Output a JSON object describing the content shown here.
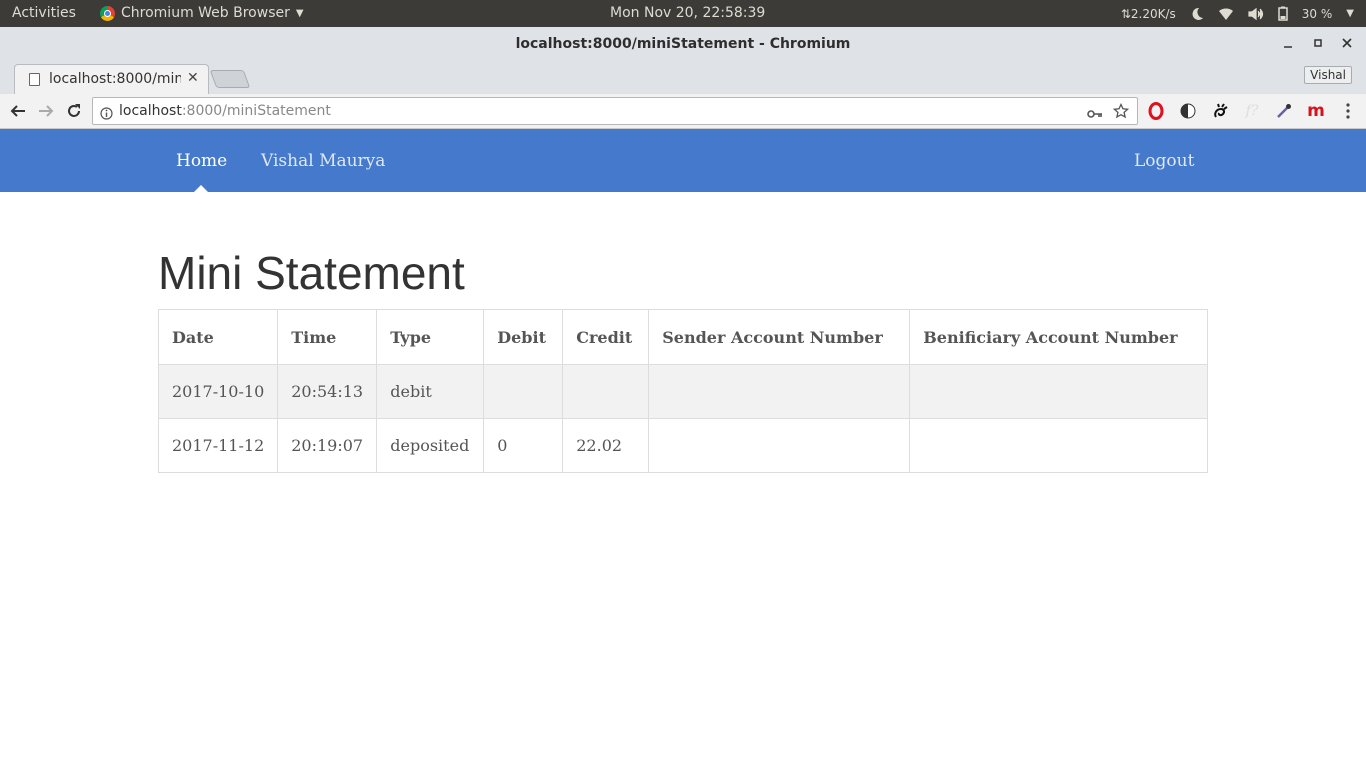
{
  "system_bar": {
    "activities": "Activities",
    "app_name": "Chromium Web Browser",
    "clock": "Mon Nov 20, 22:58:39",
    "net_speed": "⇅2.20K/s",
    "battery": "30 %"
  },
  "window": {
    "title": "localhost:8000/miniStatement - Chromium"
  },
  "tabs": [
    {
      "label": "localhost:8000/miniStatement"
    }
  ],
  "profile": {
    "name": "Vishal"
  },
  "address_bar": {
    "host": "localhost",
    "rest": ":8000/miniStatement"
  },
  "extensions": [
    "opera-icon",
    "contrast-icon",
    "gnome-icon",
    "formula-icon",
    "eyedropper-icon",
    "mendeley-icon"
  ],
  "navbar": {
    "home": "Home",
    "user": "Vishal Maurya",
    "logout": "Logout",
    "color": "#4479cc"
  },
  "page": {
    "title": "Mini Statement"
  },
  "statement_table": {
    "headers": [
      "Date",
      "Time",
      "Type",
      "Debit",
      "Credit",
      "Sender Account Number",
      "Benificiary Account Number"
    ],
    "rows": [
      [
        "2017-10-10",
        "20:54:13",
        "debit",
        "",
        "",
        "",
        ""
      ],
      [
        "2017-11-12",
        "20:19:07",
        "deposited",
        "0",
        "22.02",
        "",
        ""
      ]
    ]
  }
}
